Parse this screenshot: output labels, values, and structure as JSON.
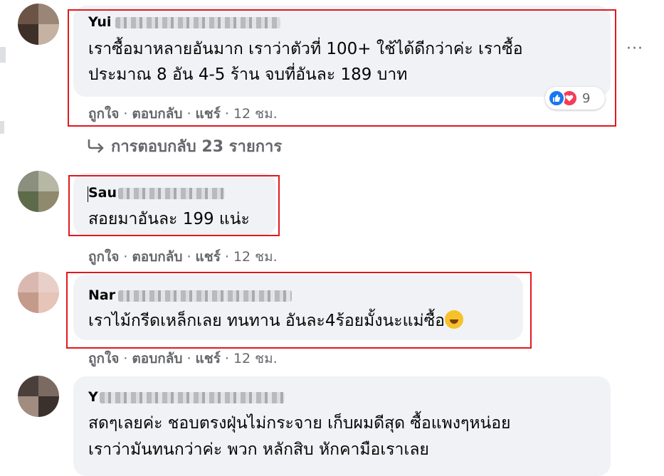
{
  "comments": [
    {
      "name": "Yui",
      "text_lines": [
        "เราซื้อมาหลายอันมาก เราว่าตัวที่ 100+ ใช้ได้ดีกว่าค่ะ เราซื้อ",
        "ประมาณ 8 อัน 4-5 ร้าน จบที่อันละ 189 บาท"
      ],
      "actions": {
        "like": "ถูกใจ",
        "reply": "ตอบกลับ",
        "share": "แชร์",
        "time": "12 ชม."
      },
      "reaction_count": "9",
      "reaction_icons": [
        "like-icon",
        "love-icon"
      ]
    },
    {
      "name": "Sau",
      "text_lines": [
        "สอยมาอันละ 199 แน่ะ"
      ],
      "actions": {
        "like": "ถูกใจ",
        "reply": "ตอบกลับ",
        "share": "แชร์",
        "time": "12 ชม."
      }
    },
    {
      "name": "Nar",
      "text_lines": [
        "เราไม้กรีดเหล็กเลย ทนทาน อันละ4ร้อยมั้งนะแม่ซื้อ"
      ],
      "emoji": "rolling-on-floor-laughing-emoji",
      "actions": {
        "like": "ถูกใจ",
        "reply": "ตอบกลับ",
        "share": "แชร์",
        "time": "12 ชม."
      }
    },
    {
      "name": "Y",
      "text_lines": [
        "สดๆเลยค่ะ ชอบตรงฝุ่นไม่กระจาย เก็บผมดีสุด ซื้อแพงๆหน่อย",
        "เราว่ามันทนกว่าค่ะ พวก หลักสิบ หักคามือเราเลย"
      ]
    }
  ],
  "view_replies": "การตอบกลับ 23 รายการ",
  "more_options": "···",
  "separator": "·",
  "colors": {
    "bubble": "#f0f2f5",
    "highlight": "#e0191e",
    "secondary_text": "#65676b",
    "like": "#1877f2",
    "love": "#f33e58"
  }
}
